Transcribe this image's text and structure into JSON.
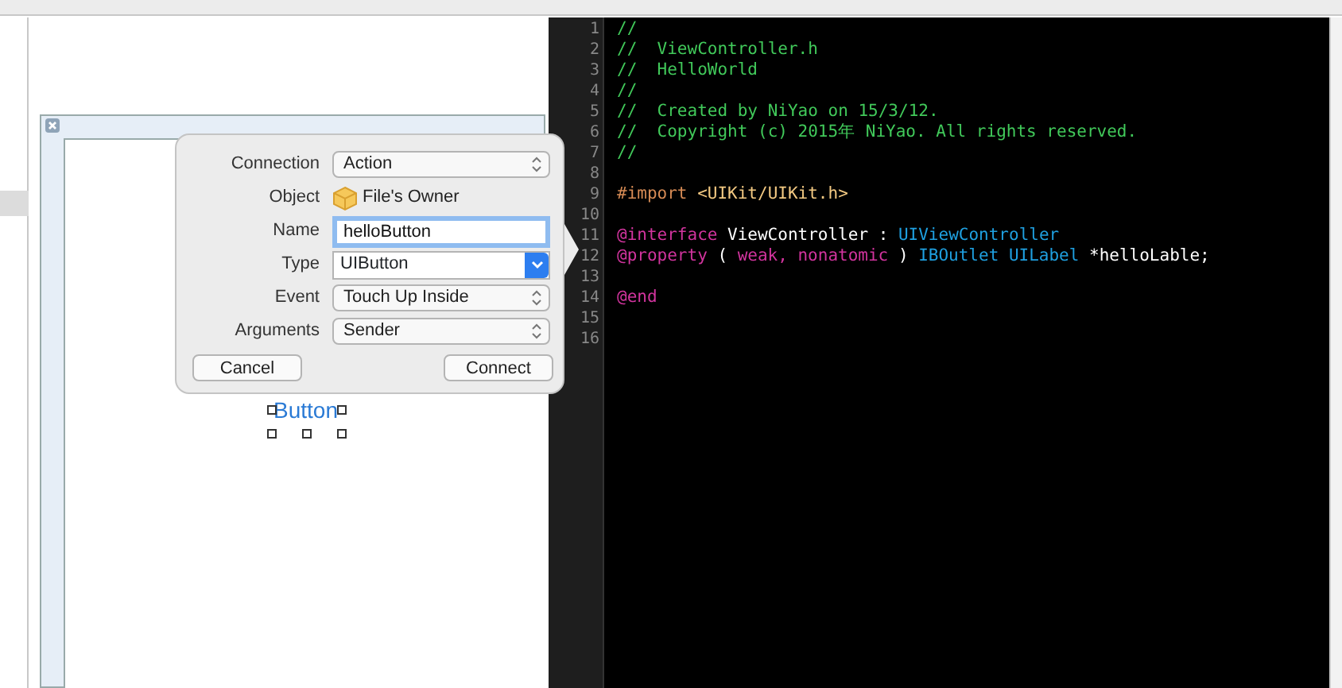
{
  "popover": {
    "fields": [
      {
        "label": "Connection",
        "kind": "popup",
        "value": "Action"
      },
      {
        "label": "Object",
        "kind": "object",
        "value": "File's Owner"
      },
      {
        "label": "Name",
        "kind": "text",
        "value": "helloButton",
        "focused": true
      },
      {
        "label": "Type",
        "kind": "combo",
        "value": "UIButton"
      },
      {
        "label": "Event",
        "kind": "popup",
        "value": "Touch Up Inside"
      },
      {
        "label": "Arguments",
        "kind": "popup",
        "value": "Sender"
      }
    ],
    "buttons": [
      "Cancel",
      "Connect"
    ]
  },
  "canvas": {
    "button_label": "Button",
    "selected": true
  },
  "editor": {
    "lines": [
      {
        "number": "1",
        "segments": [
          {
            "kind": "comment",
            "text": "//"
          }
        ]
      },
      {
        "number": "2",
        "segments": [
          {
            "kind": "comment",
            "text": "//  ViewController.h"
          }
        ]
      },
      {
        "number": "3",
        "segments": [
          {
            "kind": "comment",
            "text": "//  HelloWorld"
          }
        ]
      },
      {
        "number": "4",
        "segments": [
          {
            "kind": "comment",
            "text": "//"
          }
        ]
      },
      {
        "number": "5",
        "segments": [
          {
            "kind": "comment",
            "text": "//  Created by NiYao on 15/3/12."
          }
        ]
      },
      {
        "number": "6",
        "segments": [
          {
            "kind": "comment",
            "text": "//  Copyright (c) 2015年 NiYao. All rights reserved."
          }
        ]
      },
      {
        "number": "7",
        "segments": [
          {
            "kind": "comment",
            "text": "//"
          }
        ]
      },
      {
        "number": "8"
      },
      {
        "number": "9",
        "segments": [
          {
            "kind": "preprocessor",
            "text": "#import"
          },
          {
            "kind": "string",
            "text": "<UIKit/UIKit.h>"
          }
        ]
      },
      {
        "number": "10"
      },
      {
        "number": "11",
        "segments": [
          {
            "kind": "keyword",
            "text": "@interface"
          },
          {
            "kind": "plain",
            "text": "ViewController :"
          },
          {
            "kind": "type",
            "text": "UIViewController"
          }
        ]
      },
      {
        "number": "12",
        "segments": [
          {
            "kind": "keyword",
            "text": "@property"
          },
          {
            "kind": "plain",
            "text": "("
          },
          {
            "kind": "keyword",
            "text": "weak,"
          },
          {
            "kind": "keyword",
            "text": "nonatomic"
          },
          {
            "kind": "plain",
            "text": ")"
          },
          {
            "kind": "type",
            "text": "IBOutlet"
          },
          {
            "kind": "type",
            "text": "UILabel"
          },
          {
            "kind": "plain",
            "text": "*helloLable;"
          }
        ]
      },
      {
        "number": "13"
      },
      {
        "number": "14",
        "segments": [
          {
            "kind": "keyword",
            "text": "@end"
          }
        ]
      },
      {
        "number": "15"
      },
      {
        "number": "16"
      }
    ]
  }
}
